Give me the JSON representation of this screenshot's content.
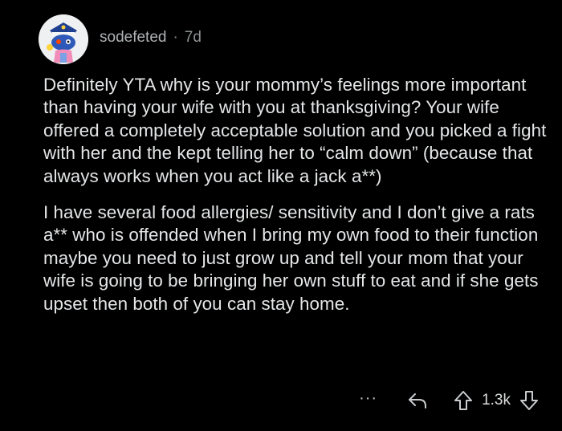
{
  "comment": {
    "username": "sodefeted",
    "separator": "·",
    "timestamp": "7d",
    "paragraphs": [
      "Definitely YTA why is your mommy’s feelings more important than having your wife with you at thanksgiving? Your wife offered a completely acceptable solution and you picked a fight with her and the kept telling her to “calm down” (because that always works when you act like a jack a**)",
      "I have several food allergies/ sensitivity and I don’t give a rats a** who is offended when I bring my own food to their function maybe you need to just grow up and tell your mom that your wife is going to be bringing her own stuff to eat and if she gets upset then both of you can stay home."
    ],
    "actions": {
      "more_label": "···",
      "vote_count": "1.3k"
    }
  },
  "colors": {
    "background": "#000000",
    "text": "#e4e6e8",
    "meta": "#8e9295",
    "accent": "#ff4500"
  },
  "icons": {
    "avatar": "snoo-avatar-sailor",
    "reply": "reply-arrow-icon",
    "upvote": "upvote-arrow-icon",
    "downvote": "downvote-arrow-icon"
  }
}
